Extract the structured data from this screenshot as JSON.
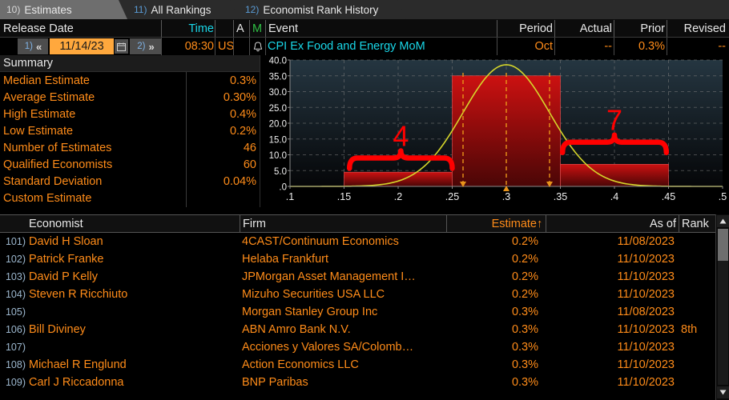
{
  "tabs": [
    {
      "num": "10)",
      "label": "Estimates",
      "active": true
    },
    {
      "num": "11)",
      "label": "All Rankings",
      "active": false
    },
    {
      "num": "12)",
      "label": "Economist Rank History",
      "active": false
    }
  ],
  "event_header": {
    "release_date": "Release Date",
    "time": "Time",
    "a": "A",
    "m": "M",
    "event": "Event",
    "period": "Period",
    "actual": "Actual",
    "prior": "Prior",
    "revised": "Revised"
  },
  "event_row": {
    "prev_num": "1)",
    "prev_arrow": "«",
    "date": "11/14/23",
    "calendar_icon": "calendar-icon",
    "next_num": "2)",
    "next_arrow": "»",
    "time": "08:30",
    "region": "US",
    "alert_icon": "bell-icon",
    "event_name": "CPI Ex Food and Energy MoM",
    "period": "Oct",
    "actual": "--",
    "prior": "0.3%",
    "revised": "--"
  },
  "summary": {
    "title": "Summary",
    "rows": [
      {
        "label": "Median Estimate",
        "value": "0.3%"
      },
      {
        "label": "Average Estimate",
        "value": "0.30%"
      },
      {
        "label": "High Estimate",
        "value": "0.4%"
      },
      {
        "label": "Low Estimate",
        "value": "0.2%"
      },
      {
        "label": "Number of Estimates",
        "value": "46"
      },
      {
        "label": "Qualified Economists",
        "value": "60"
      },
      {
        "label": "Standard Deviation",
        "value": "0.04%"
      },
      {
        "label": "Custom Estimate",
        "value": ""
      }
    ]
  },
  "chart_data": {
    "type": "bar",
    "title": "",
    "xlabel": "",
    "ylabel": "",
    "xlim": [
      0.1,
      0.5
    ],
    "ylim": [
      0.0,
      40.0
    ],
    "grid": true,
    "legend": "none",
    "x_ticks": [
      ".1",
      ".15",
      ".2",
      ".25",
      ".3",
      ".35",
      ".4",
      ".45",
      ".5"
    ],
    "x_tick_values": [
      0.1,
      0.15,
      0.2,
      0.25,
      0.3,
      0.35,
      0.4,
      0.45,
      0.5
    ],
    "y_ticks": [
      "40.0",
      "35.0",
      "30.0",
      "25.0",
      "20.0",
      "15.0",
      "10.0",
      "5.0",
      ".0"
    ],
    "y_tick_values": [
      40.0,
      35.0,
      30.0,
      25.0,
      20.0,
      15.0,
      10.0,
      5.0,
      0.0
    ],
    "bars": [
      {
        "x_start": 0.15,
        "x_end": 0.25,
        "value": 4.5
      },
      {
        "x_start": 0.25,
        "x_end": 0.35,
        "value": 35.0
      },
      {
        "x_start": 0.35,
        "x_end": 0.45,
        "value": 7.0
      }
    ],
    "bar_color": "#cc1111",
    "curve": {
      "name": "normal-distribution",
      "color": "#d6d62b",
      "mean": 0.3,
      "std_dev": 0.04,
      "peak_value": 38.5
    },
    "markers": [
      {
        "x": 0.26,
        "type": "down-triangle",
        "label": "low-marker"
      },
      {
        "x": 0.3,
        "type": "up-triangle",
        "label": "median-marker"
      },
      {
        "x": 0.34,
        "type": "down-triangle",
        "label": "high-marker"
      }
    ],
    "annotations": [
      {
        "text": "4",
        "group_start": 0.155,
        "group_end": 0.25,
        "color": "#ff0000"
      },
      {
        "text": "7",
        "group_start": 0.352,
        "group_end": 0.448,
        "color": "#ff0000"
      }
    ]
  },
  "table": {
    "headers": {
      "economist": "Economist",
      "firm": "Firm",
      "estimate": "Estimate",
      "sort_indicator": "↑",
      "as_of": "As of",
      "rank": "Rank"
    },
    "rows": [
      {
        "num": "101)",
        "economist": "David H Sloan",
        "firm": "4CAST/Continuum Economics",
        "estimate": "0.2%",
        "as_of": "11/08/2023",
        "rank": ""
      },
      {
        "num": "102)",
        "economist": "Patrick Franke",
        "firm": "Helaba Frankfurt",
        "estimate": "0.2%",
        "as_of": "11/10/2023",
        "rank": ""
      },
      {
        "num": "103)",
        "economist": "David P Kelly",
        "firm": "JPMorgan Asset Management I…",
        "estimate": "0.2%",
        "as_of": "11/10/2023",
        "rank": ""
      },
      {
        "num": "104)",
        "economist": "Steven R Ricchiuto",
        "firm": "Mizuho Securities USA LLC",
        "estimate": "0.2%",
        "as_of": "11/10/2023",
        "rank": ""
      },
      {
        "num": "105)",
        "economist": "",
        "firm": "Morgan Stanley Group Inc",
        "estimate": "0.3%",
        "as_of": "11/08/2023",
        "rank": ""
      },
      {
        "num": "106)",
        "economist": "Bill Diviney",
        "firm": "ABN Amro Bank N.V.",
        "estimate": "0.3%",
        "as_of": "11/10/2023",
        "rank": "8th"
      },
      {
        "num": "107)",
        "economist": "",
        "firm": "Acciones y Valores SA/Colomb…",
        "estimate": "0.3%",
        "as_of": "11/10/2023",
        "rank": ""
      },
      {
        "num": "108)",
        "economist": "Michael R Englund",
        "firm": "Action Economics LLC",
        "estimate": "0.3%",
        "as_of": "11/10/2023",
        "rank": ""
      },
      {
        "num": "109)",
        "economist": "Carl J Riccadonna",
        "firm": "BNP Paribas",
        "estimate": "0.3%",
        "as_of": "11/10/2023",
        "rank": ""
      }
    ]
  },
  "scrollbar": {
    "up_icon": "scroll-up-arrow-icon",
    "down_icon": "scroll-down-arrow-icon"
  },
  "colors": {
    "orange": "#ff8c19",
    "cyan": "#19d7e8",
    "highlight": "#ffa83d",
    "bar_red": "#cc1111",
    "curve_yellow": "#d6d62b",
    "annotation_red": "#ff0000"
  }
}
